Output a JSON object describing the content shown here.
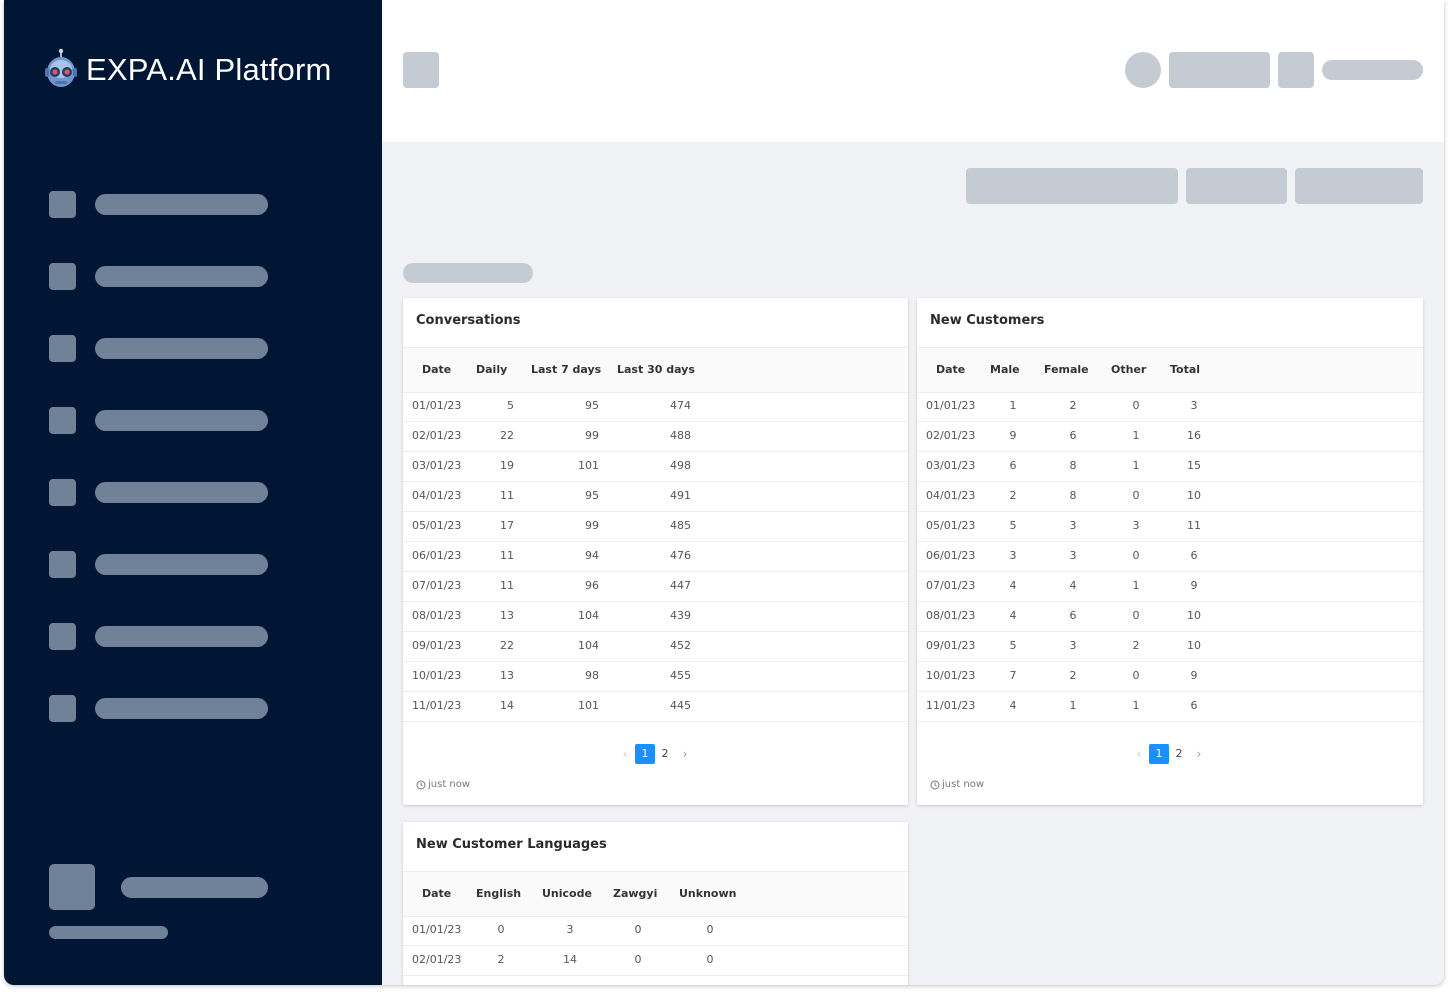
{
  "app": {
    "title": "EXPA.AI Platform"
  },
  "conversations": {
    "title": "Conversations",
    "columns": [
      "Date",
      "Daily",
      "Last 7 days",
      "Last 30 days"
    ],
    "rows": [
      [
        "01/01/23",
        "5",
        "95",
        "474"
      ],
      [
        "02/01/23",
        "22",
        "99",
        "488"
      ],
      [
        "03/01/23",
        "19",
        "101",
        "498"
      ],
      [
        "04/01/23",
        "11",
        "95",
        "491"
      ],
      [
        "05/01/23",
        "17",
        "99",
        "485"
      ],
      [
        "06/01/23",
        "11",
        "94",
        "476"
      ],
      [
        "07/01/23",
        "11",
        "96",
        "447"
      ],
      [
        "08/01/23",
        "13",
        "104",
        "439"
      ],
      [
        "09/01/23",
        "22",
        "104",
        "452"
      ],
      [
        "10/01/23",
        "13",
        "98",
        "455"
      ],
      [
        "11/01/23",
        "14",
        "101",
        "445"
      ]
    ],
    "pagination": {
      "current": "1",
      "next": "2"
    },
    "updated": "just now"
  },
  "new_customers": {
    "title": "New Customers",
    "columns": [
      "Date",
      "Male",
      "Female",
      "Other",
      "Total"
    ],
    "rows": [
      [
        "01/01/23",
        "1",
        "2",
        "0",
        "3"
      ],
      [
        "02/01/23",
        "9",
        "6",
        "1",
        "16"
      ],
      [
        "03/01/23",
        "6",
        "8",
        "1",
        "15"
      ],
      [
        "04/01/23",
        "2",
        "8",
        "0",
        "10"
      ],
      [
        "05/01/23",
        "5",
        "3",
        "3",
        "11"
      ],
      [
        "06/01/23",
        "3",
        "3",
        "0",
        "6"
      ],
      [
        "07/01/23",
        "4",
        "4",
        "1",
        "9"
      ],
      [
        "08/01/23",
        "4",
        "6",
        "0",
        "10"
      ],
      [
        "09/01/23",
        "5",
        "3",
        "2",
        "10"
      ],
      [
        "10/01/23",
        "7",
        "2",
        "0",
        "9"
      ],
      [
        "11/01/23",
        "4",
        "1",
        "1",
        "6"
      ]
    ],
    "pagination": {
      "current": "1",
      "next": "2"
    },
    "updated": "just now"
  },
  "languages": {
    "title": "New Customer Languages",
    "columns": [
      "Date",
      "English",
      "Unicode",
      "Zawgyi",
      "Unknown"
    ],
    "rows": [
      [
        "01/01/23",
        "0",
        "3",
        "0",
        "0"
      ],
      [
        "02/01/23",
        "2",
        "14",
        "0",
        "0"
      ]
    ]
  },
  "colors": {
    "sidebar": "#001634",
    "skeleton_dark": "#6f8298",
    "skeleton_light": "#c5cbd3",
    "accent": "#1890ff"
  },
  "icons": {
    "logo": "robot-logo-icon",
    "clock": "clock-icon",
    "prev": "chevron-left-icon",
    "next": "chevron-right-icon"
  }
}
